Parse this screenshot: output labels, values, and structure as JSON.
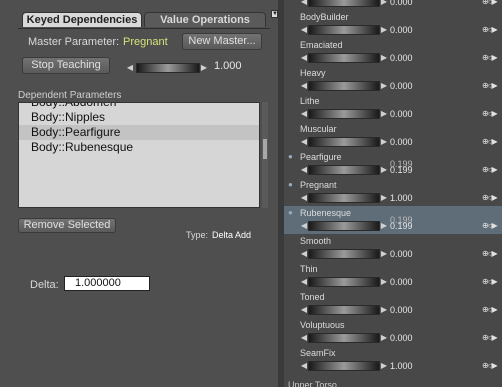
{
  "tabs": [
    {
      "label": "Keyed Dependencies",
      "active": true
    },
    {
      "label": "Value Operations",
      "active": false
    }
  ],
  "master": {
    "label": "Master Parameter:",
    "value": "Pregnant",
    "new_button": "New Master..."
  },
  "teaching": {
    "stop_button": "Stop Teaching",
    "value": "1.000"
  },
  "dependents": {
    "title": "Dependent Parameters",
    "items": [
      {
        "label": "Body::Nipples",
        "selected": false
      },
      {
        "label": "Body::Pearfigure",
        "selected": true
      },
      {
        "label": "Body::Rubenesque",
        "selected": false
      }
    ],
    "clipped_item": "Body::Abdomen"
  },
  "remove_button": "Remove Selected",
  "type": {
    "label": "Type:",
    "value": "Delta Add"
  },
  "delta": {
    "label": "Delta:",
    "value": "1.000000"
  },
  "properties": [
    {
      "name": "",
      "value": "0.000",
      "clipped": true
    },
    {
      "name": "BodyBuilder",
      "value": "0.000"
    },
    {
      "name": "Emaciated",
      "value": "0.000"
    },
    {
      "name": "Heavy",
      "value": "0.000"
    },
    {
      "name": "Lithe",
      "value": "0.000"
    },
    {
      "name": "Muscular",
      "value": "0.000"
    },
    {
      "name": "Pearfigure",
      "value": "0.199",
      "value2": "0.199",
      "dot": true
    },
    {
      "name": "Pregnant",
      "value": "1.000",
      "dot": true
    },
    {
      "name": "Rubenesque",
      "value": "0.199",
      "value2": "0.199",
      "dot": true,
      "selected": true
    },
    {
      "name": "Smooth",
      "value": "0.000"
    },
    {
      "name": "Thin",
      "value": "0.000"
    },
    {
      "name": "Toned",
      "value": "0.000"
    },
    {
      "name": "Voluptuous",
      "value": "0.000"
    },
    {
      "name": "SeamFix",
      "value": "1.000"
    }
  ],
  "group_label": "Upper Torso",
  "icons": {
    "left_arrow": "left-arrow-icon",
    "right_arrow": "right-arrow-icon",
    "dial": "dial-icon",
    "bullet": "bullet-icon"
  }
}
